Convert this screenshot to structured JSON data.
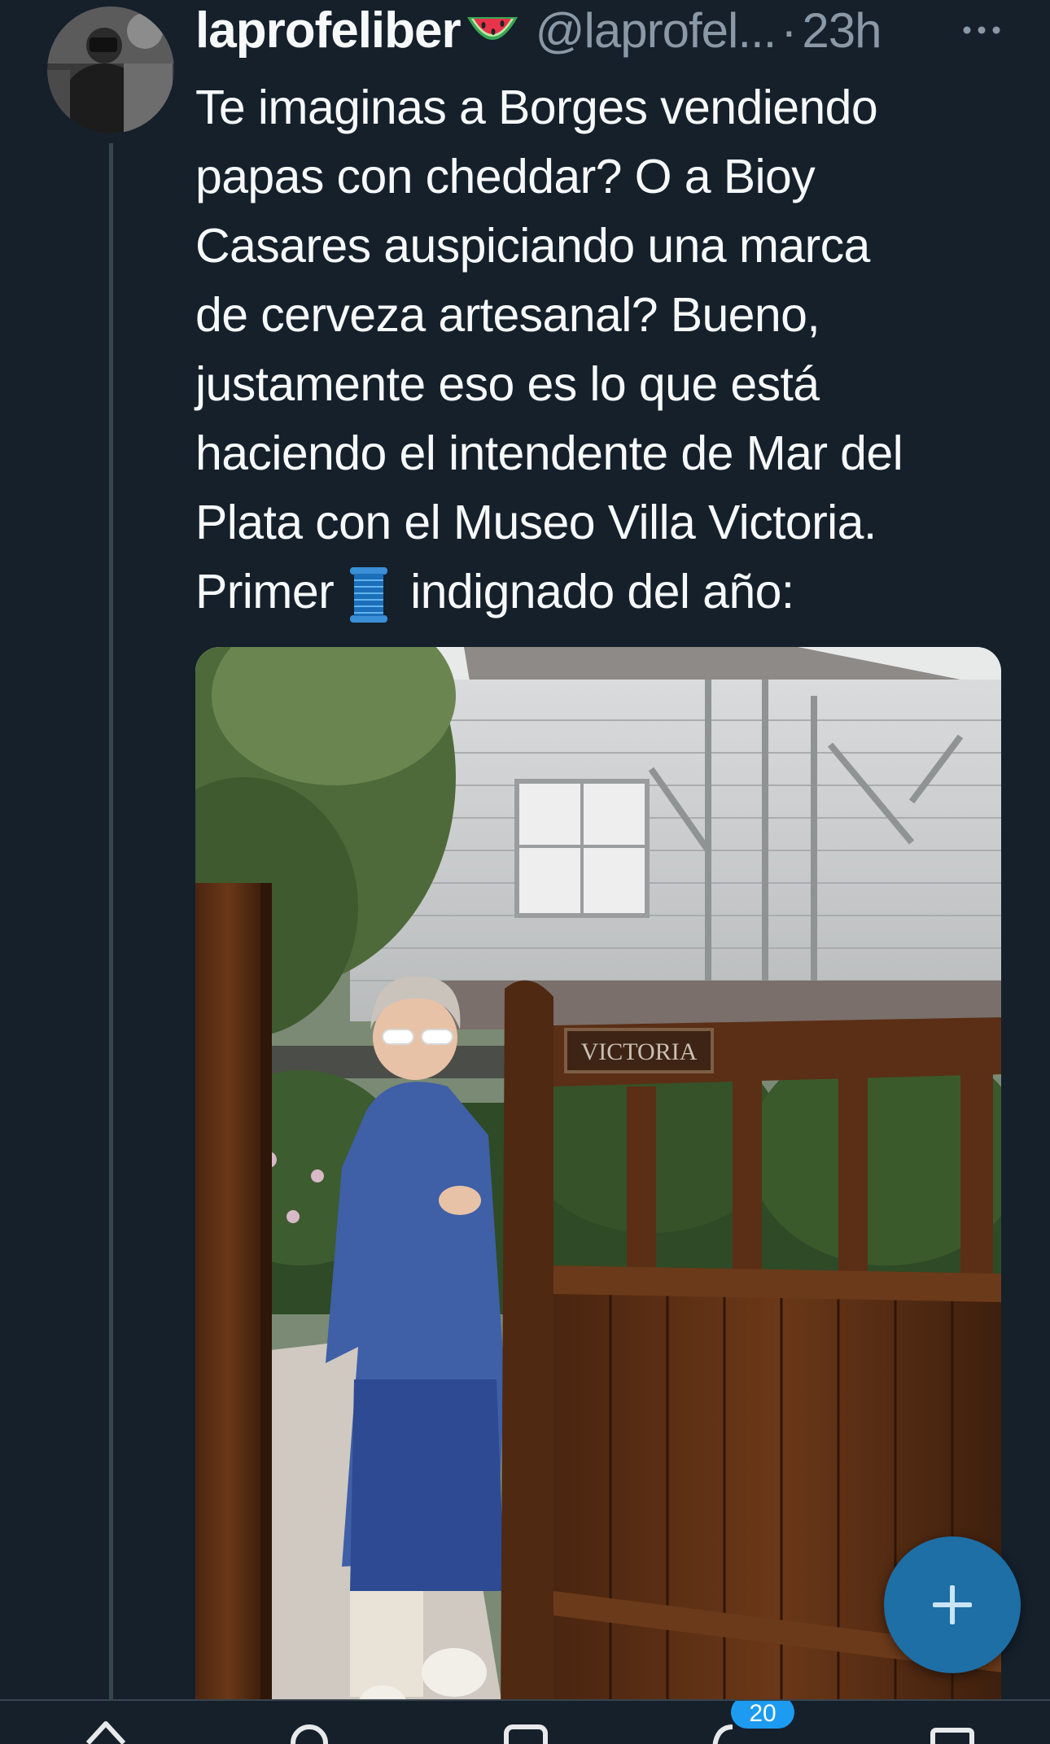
{
  "tweet": {
    "display_name": "laprofeliber",
    "name_emoji": "watermelon-emoji",
    "handle": "@laprofel...",
    "separator": "·",
    "time": "23h",
    "text_lines": [
      "Te imaginas a Borges vendiendo",
      "papas con cheddar? O a Bioy",
      "Casares auspiciando una marca",
      "de cerveza artesanal? Bueno,",
      "justamente eso es lo que está",
      "haciendo el intendente de Mar del",
      "Plata con el Museo Villa Victoria."
    ],
    "last_line_before": "Primer",
    "last_line_emoji": "spool-of-thread-emoji",
    "last_line_after": "indignado del año:",
    "media": {
      "gate_sign": "VICTORIA"
    }
  },
  "nav": {
    "items": [
      "home-icon",
      "search-icon",
      "communities-icon",
      "notifications-icon",
      "messages-icon"
    ],
    "notifications_badge": "20"
  },
  "colors": {
    "background": "#15202b",
    "text_primary": "#f7f9f9",
    "text_secondary": "#8b98a5",
    "accent": "#1d9bf0",
    "fab": "#1d6fa5"
  }
}
